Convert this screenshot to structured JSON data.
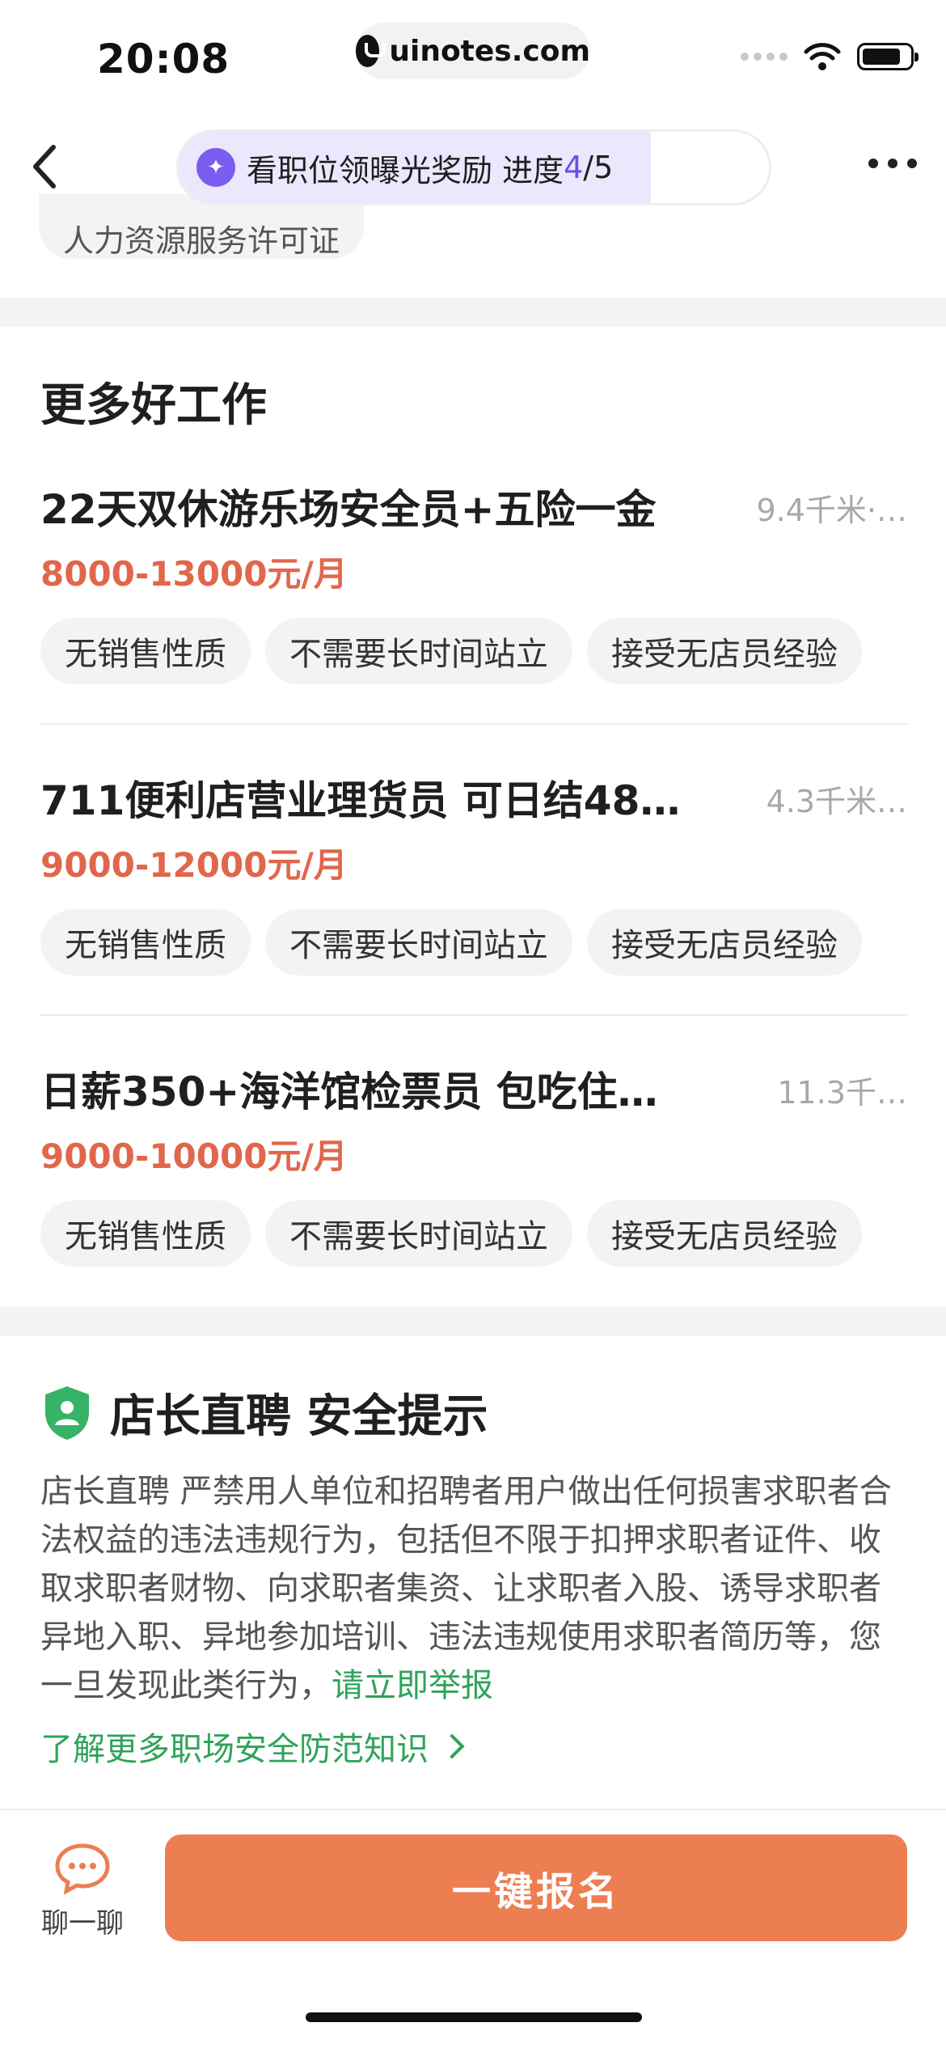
{
  "status_bar": {
    "time": "20:08",
    "url": "uinotes.com"
  },
  "nav": {
    "back_icon": "chevron-left-icon",
    "progress": {
      "label": "看职位领曝光奖励 进度",
      "current": "4",
      "total": "/5",
      "fraction": 0.8
    },
    "more_icon": "more-horizontal-icon"
  },
  "license_chip": "人力资源服务许可证",
  "more_jobs": {
    "title": "更多好工作",
    "jobs": [
      {
        "title": "22天双休游乐场安全员+五险一金",
        "distance": "9.4千米·…",
        "salary": "8000-13000元/月",
        "tags": [
          "无销售性质",
          "不需要长时间站立",
          "接受无店员经验"
        ]
      },
      {
        "title": "711便利店营业理货员 可日结48…",
        "distance": "4.3千米…",
        "salary": "9000-12000元/月",
        "tags": [
          "无销售性质",
          "不需要长时间站立",
          "接受无店员经验"
        ]
      },
      {
        "title": "日薪350+海洋馆检票员 包吃住…",
        "distance": "11.3千…",
        "salary": "9000-10000元/月",
        "tags": [
          "无销售性质",
          "不需要长时间站立",
          "接受无店员经验"
        ]
      }
    ]
  },
  "safety": {
    "icon": "shield-user-icon",
    "title": "店长直聘 安全提示",
    "body": "店长直聘 严禁用人单位和招聘者用户做出任何损害求职者合法权益的违法违规行为，包括但不限于扣押求职者证件、收取求职者财物、向求职者集资、让求职者入股、诱导求职者异地入职、异地参加培训、违法违规使用求职者简历等，您一旦发现此类行为，",
    "report_link": "请立即举报",
    "learn_more": "了解更多职场安全防范知识"
  },
  "bottom_bar": {
    "chat_label": "聊一聊",
    "chat_icon": "chat-bubble-icon",
    "apply_label": "一键报名"
  },
  "colors": {
    "accent_orange": "#ec7e52",
    "salary_red": "#e0674c",
    "safety_green": "#2fa35a",
    "progress_purple": "#6b4fe8"
  }
}
